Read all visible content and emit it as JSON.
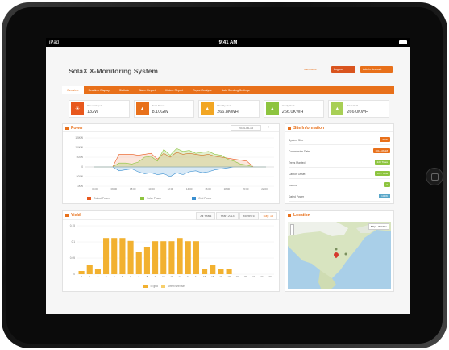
{
  "device": {
    "carrier": "iPad",
    "time": "9:41 AM"
  },
  "app": {
    "title": "SolaX X-Monitoring System",
    "header_user": "username",
    "header_btn_logout": "Log out",
    "header_btn_settings": "Admin Account"
  },
  "nav": {
    "tabs": [
      "Overview",
      "Realtime Display",
      "Statistic",
      "Alarm Report",
      "History Report",
      "Report Analyse",
      "Auto Sending Settings"
    ]
  },
  "cards": [
    {
      "label": "Power Output",
      "value": "132W",
      "color": "#e8581d",
      "icon": "sun-icon"
    },
    {
      "label": "Total Power",
      "value": "8.10GW",
      "color": "#e8701a",
      "icon": "power-icon"
    },
    {
      "label": "Monthly Yield",
      "value": "266.8KWH",
      "color": "#f2a623",
      "icon": "chart-icon"
    },
    {
      "label": "Yearly Yield",
      "value": "266.0KWH",
      "color": "#8dc43f",
      "icon": "chart-icon"
    },
    {
      "label": "Total Yield",
      "value": "266.0KWH",
      "color": "#a8cf55",
      "icon": "chart-icon"
    }
  ],
  "power_panel": {
    "title": "Power",
    "date": "2014-06-18",
    "legend": [
      {
        "name": "Output Power",
        "color": "#e8581d"
      },
      {
        "name": "Solar Power",
        "color": "#8dc43f"
      },
      {
        "name": "Grid Power",
        "color": "#3a8fd0"
      }
    ]
  },
  "site_panel": {
    "title": "Site Information",
    "rows": [
      {
        "label": "System Size",
        "value": "6KW",
        "color": "#e8701a"
      },
      {
        "label": "Commission Date",
        "value": "2014-06-18",
        "color": "#e8701a"
      },
      {
        "label": "Trees Planted",
        "value": "220 Trees",
        "color": "#8dc43f"
      },
      {
        "label": "Carbon Offset",
        "value": "0.27 Tons",
        "color": "#8dc43f"
      },
      {
        "label": "Income",
        "value": "0",
        "color": "#8dc43f"
      },
      {
        "label": "Dated Power",
        "value": "100W",
        "color": "#5aa7c9"
      }
    ]
  },
  "yield_panel": {
    "title": "Yield",
    "tabs": [
      "All Years",
      "Year: 2014",
      "Month: 6",
      "Day: 18"
    ],
    "active_tab": 3,
    "legend": [
      "To grid",
      "Direct self use"
    ]
  },
  "location_panel": {
    "title": "Location",
    "map_btn_map": "Map",
    "map_btn_sat": "Satellite"
  },
  "chart_data": [
    {
      "type": "area",
      "title": "Power",
      "y_ticks": [
        "1.5KW",
        "1.0KW",
        "500W",
        "0",
        "-500W",
        "-1KW"
      ],
      "x_ticks": [
        "04:00",
        "06:00",
        "08:00",
        "10:00",
        "12:00",
        "14:00",
        "16:00",
        "18:00",
        "20:00",
        "22:00"
      ],
      "series": [
        {
          "name": "Output Power",
          "values": [
            0,
            0,
            0,
            0,
            650,
            650,
            650,
            600,
            650,
            700,
            400,
            700,
            500,
            750,
            650,
            700,
            650,
            600,
            650,
            550,
            500,
            450,
            400,
            350,
            300,
            0,
            0,
            0
          ]
        },
        {
          "name": "Solar Power",
          "values": [
            0,
            0,
            0,
            0,
            200,
            200,
            150,
            250,
            500,
            550,
            300,
            900,
            600,
            950,
            800,
            850,
            700,
            750,
            800,
            650,
            600,
            400,
            300,
            150,
            100,
            0,
            0,
            0
          ]
        },
        {
          "name": "Grid Power",
          "values": [
            0,
            0,
            0,
            0,
            -200,
            -150,
            -100,
            -250,
            -350,
            -300,
            -400,
            -350,
            -500,
            -300,
            -400,
            -250,
            -200,
            -300,
            -250,
            -150,
            -100,
            -50,
            0,
            0,
            0,
            0,
            0,
            0
          ]
        }
      ]
    },
    {
      "type": "bar",
      "title": "Yield",
      "y_ticks": [
        "0.15",
        "0.1",
        "0.05",
        "0"
      ],
      "categories": [
        "0",
        "1",
        "2",
        "3",
        "4",
        "5",
        "6",
        "7",
        "8",
        "9",
        "10",
        "11",
        "12",
        "13",
        "14",
        "15",
        "16",
        "17",
        "18",
        "19",
        "20",
        "21",
        "22",
        "23"
      ],
      "series": [
        {
          "name": "To grid",
          "values": [
            0.01,
            0.03,
            0.015,
            0.112,
            0.112,
            0.112,
            0.103,
            0.07,
            0.085,
            0.102,
            0.102,
            0.102,
            0.112,
            0.102,
            0.102,
            0.016,
            0.028,
            0.016,
            0.016,
            0,
            0,
            0,
            0,
            0
          ]
        }
      ]
    }
  ]
}
